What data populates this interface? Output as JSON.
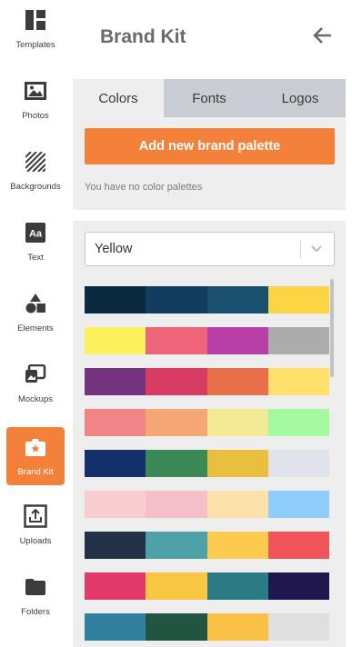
{
  "nav": {
    "items": [
      {
        "label": "Templates",
        "icon": "templates-icon"
      },
      {
        "label": "Photos",
        "icon": "photo-icon"
      },
      {
        "label": "Backgrounds",
        "icon": "backgrounds-icon"
      },
      {
        "label": "Text",
        "icon": "text-icon"
      },
      {
        "label": "Elements",
        "icon": "elements-icon"
      },
      {
        "label": "Mockups",
        "icon": "mockups-icon"
      },
      {
        "label": "Brand Kit",
        "icon": "brand-kit-icon",
        "active": true
      },
      {
        "label": "Uploads",
        "icon": "upload-icon"
      },
      {
        "label": "Folders",
        "icon": "folder-icon"
      }
    ]
  },
  "header": {
    "title": "Brand Kit",
    "back_icon": "arrow-left-icon"
  },
  "tabs": [
    {
      "label": "Colors",
      "active": true
    },
    {
      "label": "Fonts",
      "active": false
    },
    {
      "label": "Logos",
      "active": false
    }
  ],
  "brand": {
    "add_label": "Add new brand palette",
    "empty_text": "You have no color palettes"
  },
  "palette_filter": {
    "selected": "Yellow"
  },
  "colors": {
    "accent": "#f4813a",
    "panel": "#eeeeee",
    "tab_inactive": "#c9cdd3"
  },
  "palettes": [
    [
      "#0b2a40",
      "#123d5e",
      "#1b5070",
      "#fcd545"
    ],
    [
      "#fbf25e",
      "#ef6479",
      "#b73fa6",
      "#acacac"
    ],
    [
      "#74337f",
      "#d93c63",
      "#e87049",
      "#fee06c"
    ],
    [
      "#f08486",
      "#f5a876",
      "#f3ea94",
      "#a4f8a0"
    ],
    [
      "#13306d",
      "#3a8957",
      "#e9bf3f",
      "#e1e3ec"
    ],
    [
      "#f8cdd0",
      "#f6bec9",
      "#fde1aa",
      "#8ecdfd"
    ],
    [
      "#233146",
      "#4fa1a8",
      "#fcca4f",
      "#f05459"
    ],
    [
      "#e2396a",
      "#fac744",
      "#2a7b83",
      "#1f174e"
    ],
    [
      "#31809f",
      "#22553f",
      "#fabf45",
      "#dfdfdf"
    ]
  ]
}
